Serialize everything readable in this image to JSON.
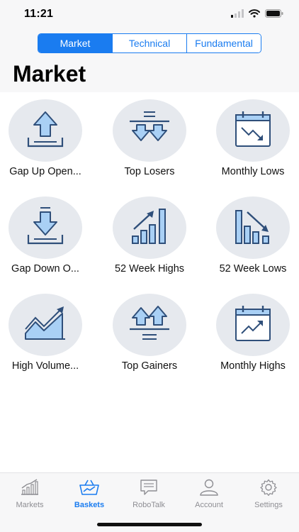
{
  "status_bar": {
    "time": "11:21"
  },
  "header": {
    "segments": [
      {
        "label": "Market",
        "active": true
      },
      {
        "label": "Technical",
        "active": false
      },
      {
        "label": "Fundamental",
        "active": false
      }
    ],
    "title": "Market"
  },
  "tiles": [
    {
      "label": "Gap Up Open...",
      "icon": "gap-up-icon"
    },
    {
      "label": "Top Losers",
      "icon": "top-losers-icon"
    },
    {
      "label": "Monthly Lows",
      "icon": "monthly-lows-icon"
    },
    {
      "label": "Gap Down O...",
      "icon": "gap-down-icon"
    },
    {
      "label": "52 Week Highs",
      "icon": "week-highs-icon"
    },
    {
      "label": "52 Week Lows",
      "icon": "week-lows-icon"
    },
    {
      "label": "High Volume...",
      "icon": "high-volume-icon"
    },
    {
      "label": "Top Gainers",
      "icon": "top-gainers-icon"
    },
    {
      "label": "Monthly Highs",
      "icon": "monthly-highs-icon"
    }
  ],
  "tabbar": {
    "items": [
      {
        "label": "Markets",
        "icon": "chart-icon",
        "active": false
      },
      {
        "label": "Baskets",
        "icon": "basket-icon",
        "active": true
      },
      {
        "label": "RoboTalk",
        "icon": "chat-icon",
        "active": false
      },
      {
        "label": "Account",
        "icon": "person-icon",
        "active": false
      },
      {
        "label": "Settings",
        "icon": "gear-icon",
        "active": false
      }
    ]
  },
  "colors": {
    "accent": "#1a7cf0",
    "icon_stroke": "#2f4f7a",
    "icon_fill": "#a9d0f5",
    "circle_bg": "#e6e9ee"
  }
}
